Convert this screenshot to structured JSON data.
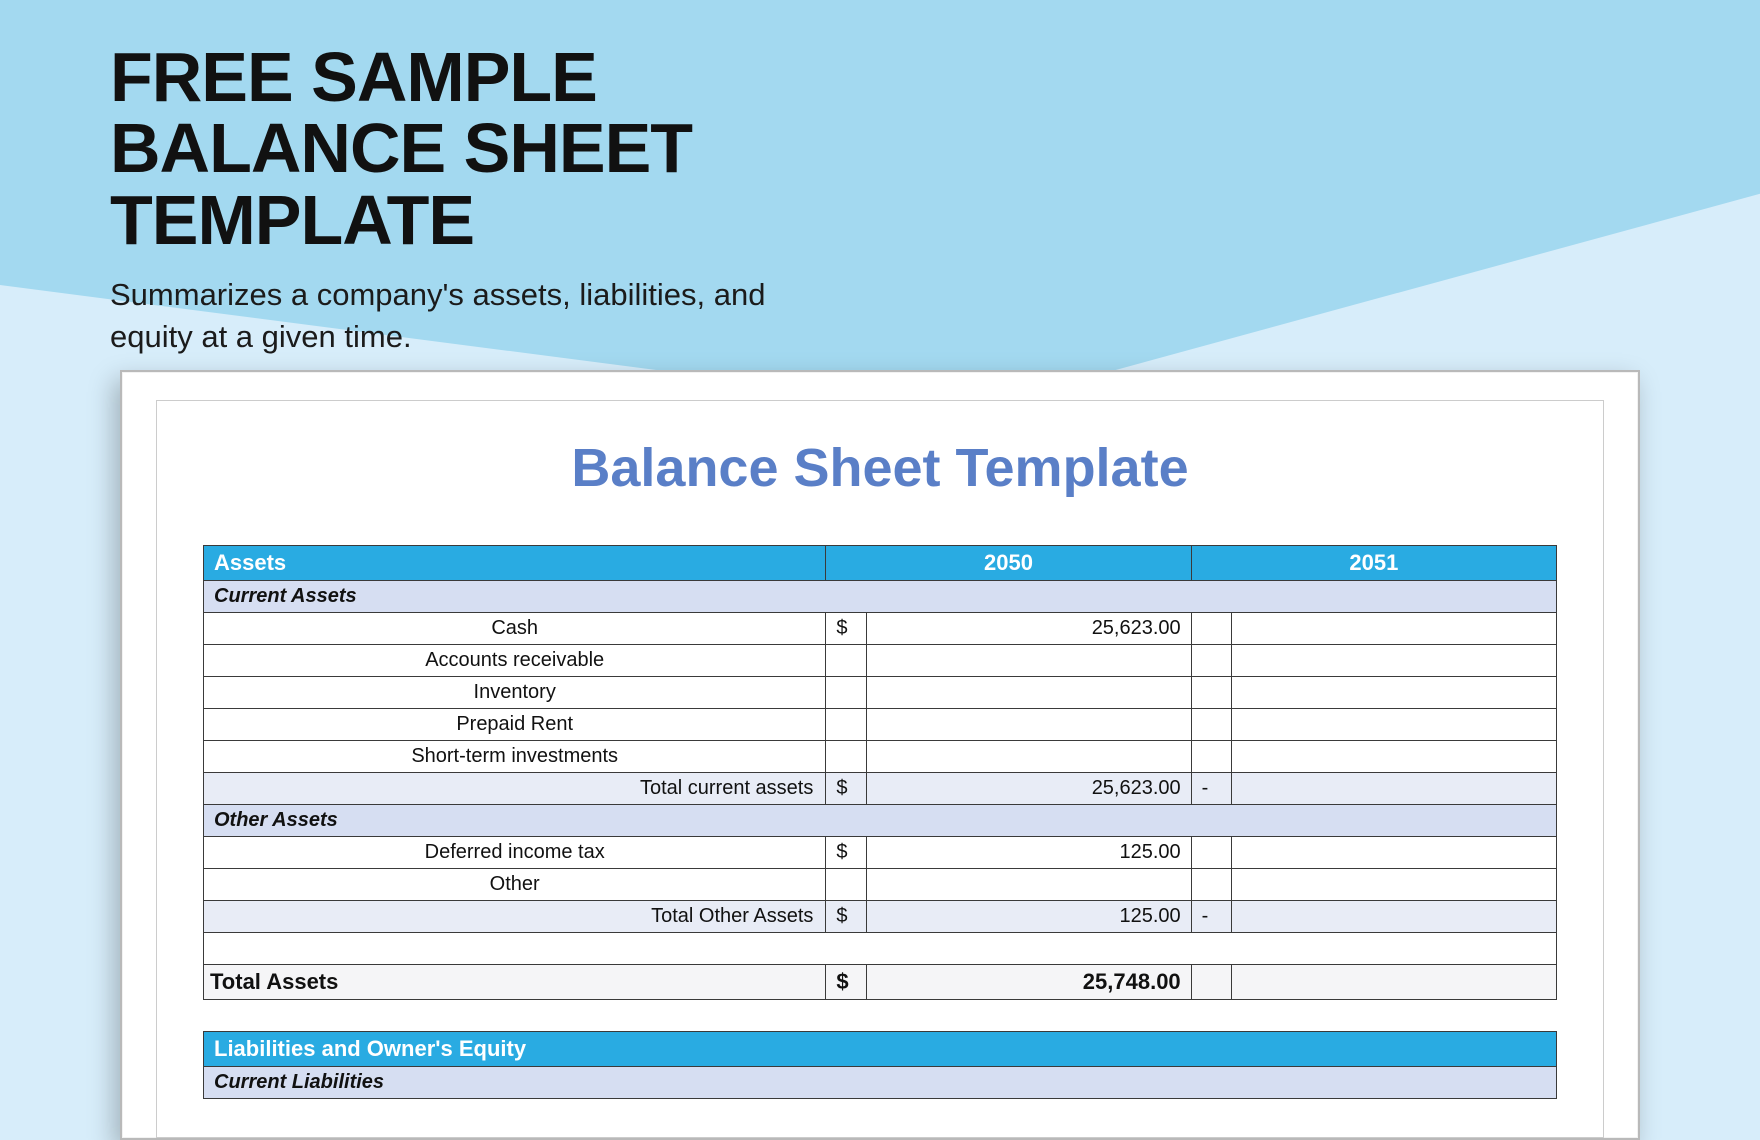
{
  "hero": {
    "title": "FREE SAMPLE BALANCE SHEET TEMPLATE",
    "subtitle": "Summarizes a company's assets, liabilities, and equity at a given time."
  },
  "doc": {
    "title": "Balance Sheet Template",
    "years": {
      "y1": "2050",
      "y2": "2051"
    },
    "sections": {
      "assets_header": "Assets",
      "current_assets_header": "Current Assets",
      "other_assets_header": "Other Assets",
      "liabilities_header": "Liabilities and Owner's Equity",
      "current_liabilities_header": "Current Liabilities"
    },
    "rows": {
      "cash": {
        "label": "Cash",
        "y1_sym": "$",
        "y1_val": "25,623.00",
        "y2_sym": "",
        "y2_val": ""
      },
      "ar": {
        "label": "Accounts receivable",
        "y1_sym": "",
        "y1_val": "",
        "y2_sym": "",
        "y2_val": ""
      },
      "inventory": {
        "label": "Inventory",
        "y1_sym": "",
        "y1_val": "",
        "y2_sym": "",
        "y2_val": ""
      },
      "prepaid": {
        "label": "Prepaid Rent",
        "y1_sym": "",
        "y1_val": "",
        "y2_sym": "",
        "y2_val": ""
      },
      "sti": {
        "label": "Short-term investments",
        "y1_sym": "",
        "y1_val": "",
        "y2_sym": "",
        "y2_val": ""
      },
      "tca": {
        "label": "Total current assets",
        "y1_sym": "$",
        "y1_val": "25,623.00",
        "y2_sym": "-",
        "y2_val": ""
      },
      "dit": {
        "label": "Deferred income tax",
        "y1_sym": "$",
        "y1_val": "125.00",
        "y2_sym": "",
        "y2_val": ""
      },
      "other": {
        "label": "Other",
        "y1_sym": "",
        "y1_val": "",
        "y2_sym": "",
        "y2_val": ""
      },
      "toa": {
        "label": "Total Other Assets",
        "y1_sym": "$",
        "y1_val": "125.00",
        "y2_sym": "-",
        "y2_val": ""
      },
      "total_assets": {
        "label": "Total Assets",
        "y1_sym": "$",
        "y1_val": "25,748.00",
        "y2_sym": "",
        "y2_val": ""
      }
    }
  }
}
